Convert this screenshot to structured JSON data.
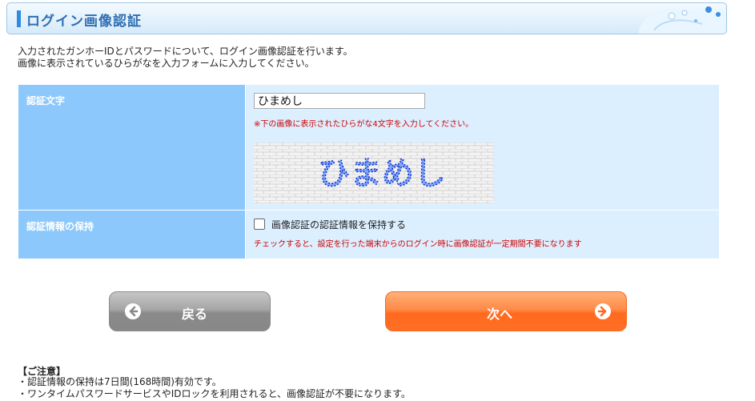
{
  "header": {
    "title": "ログイン画像認証"
  },
  "intro": {
    "line1": "入力されたガンホーIDとパスワードについて、ログイン画像認証を行います。",
    "line2": "画像に表示されているひらがなを入力フォームに入力してください。"
  },
  "form": {
    "captcha_label": "認証文字",
    "captcha_value": "ひまめし",
    "captcha_note": "※下の画像に表示されたひらがな4文字を入力してください。",
    "captcha_image_text": "ひまめし",
    "remember_label": "認証情報の保持",
    "remember_checkbox_label": "画像認証の認証情報を保持する",
    "remember_checked": false,
    "remember_note": "チェックすると、設定を行った端末からのログイン時に画像認証が一定期間不要になります"
  },
  "buttons": {
    "back": "戻る",
    "next": "次へ"
  },
  "caution": {
    "title": "【ご注意】",
    "items": [
      "・認証情報の保持は7日間(168時間)有効です。",
      "・ワンタイムパスワードサービスやIDロックを利用されると、画像認証が不要になります。"
    ]
  },
  "colors": {
    "accent": "#2f8be0",
    "label_bg": "#8cc8fb",
    "value_bg": "#dcefff",
    "note_red": "#cc0000",
    "next_orange": "#ff6a1f",
    "back_gray": "#8a8a8a"
  },
  "icons": {
    "back": "arrow-left-circle-icon",
    "next": "arrow-right-circle-icon"
  }
}
